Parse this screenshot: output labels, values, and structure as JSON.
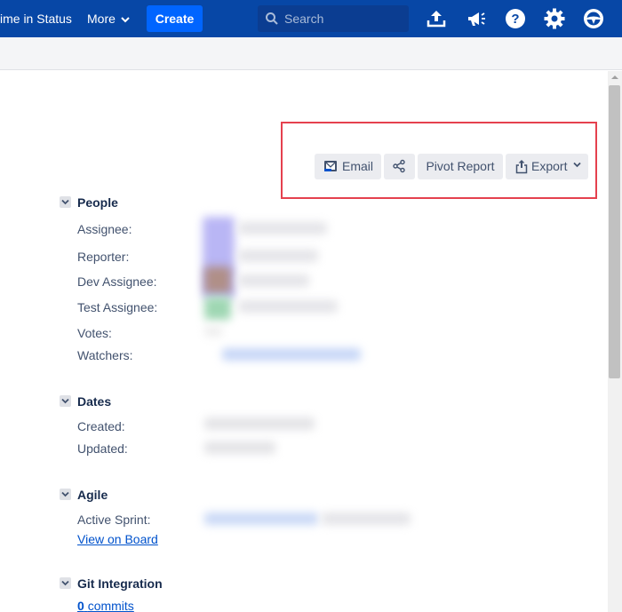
{
  "nav": {
    "left_item": "ime in Status",
    "more_label": "More",
    "create_label": "Create",
    "search_placeholder": "Search",
    "icons": [
      "upload-icon",
      "megaphone-icon",
      "help-icon",
      "settings-icon",
      "steering-wheel-icon"
    ]
  },
  "toolbar": {
    "email_label": "Email",
    "share_icon": "share-icon",
    "pivot_label": "Pivot Report",
    "export_label": "Export"
  },
  "people": {
    "title": "People",
    "assignee_label": "Assignee:",
    "reporter_label": "Reporter:",
    "dev_assignee_label": "Dev Assignee:",
    "test_assignee_label": "Test Assignee:",
    "votes_label": "Votes:",
    "watchers_label": "Watchers:"
  },
  "dates": {
    "title": "Dates",
    "created_label": "Created:",
    "updated_label": "Updated:"
  },
  "agile": {
    "title": "Agile",
    "active_sprint_label": "Active Sprint:",
    "view_on_board_label": "View on Board"
  },
  "git": {
    "title": "Git Integration",
    "commits_count": "0",
    "commits_label": "commits"
  },
  "colors": {
    "nav_bg": "#0747a6",
    "create_bg": "#0065ff",
    "highlight": "#e5414e",
    "link": "#0052cc"
  }
}
